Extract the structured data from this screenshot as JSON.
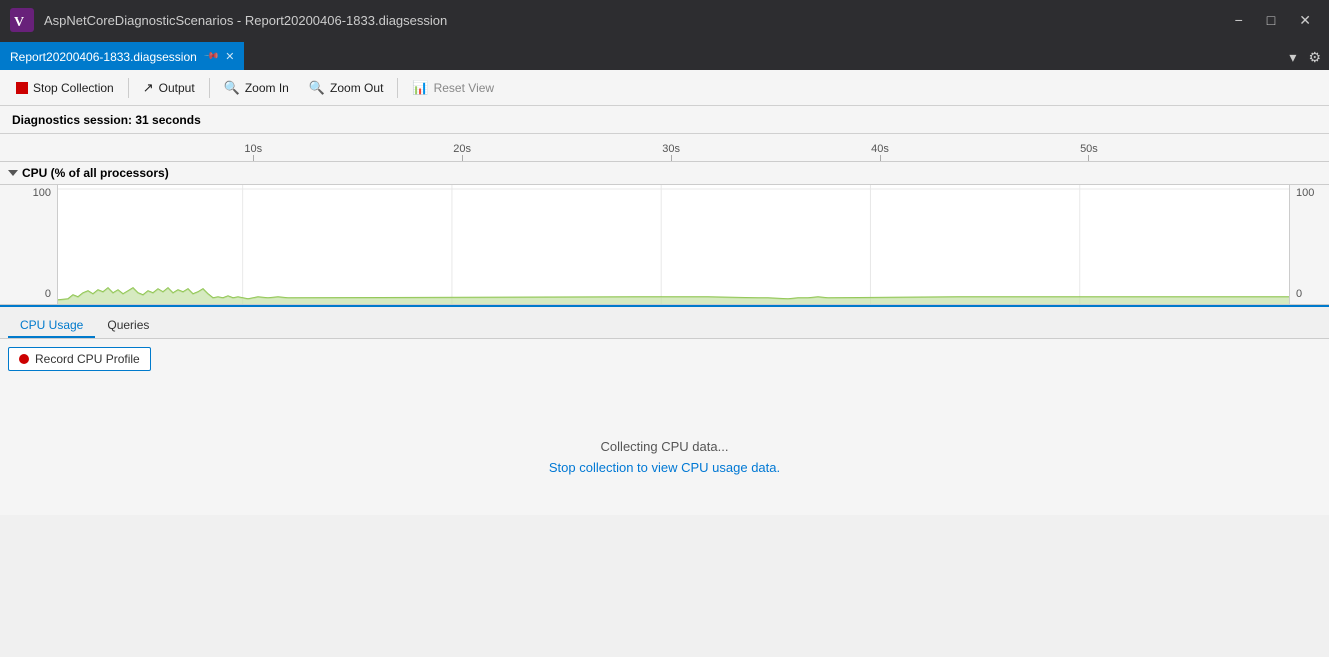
{
  "titleBar": {
    "appName": "AspNetCoreDiagnosticScenarios - Report20200406-1833.diagsession",
    "minimizeLabel": "−",
    "maximizeLabel": "□",
    "closeLabel": "✕"
  },
  "tabBar": {
    "tabName": "Report20200406-1833.diagsession",
    "pinSymbol": "📌",
    "closeSymbol": "✕",
    "dropdownSymbol": "▾",
    "settingsSymbol": "⚙"
  },
  "toolbar": {
    "stopCollection": "Stop Collection",
    "output": "Output",
    "zoomIn": "Zoom In",
    "zoomOut": "Zoom Out",
    "resetView": "Reset View"
  },
  "sessionInfo": {
    "text": "Diagnostics session: 31 seconds"
  },
  "ruler": {
    "marks": [
      "10s",
      "20s",
      "30s",
      "40s",
      "50s"
    ]
  },
  "chart": {
    "title": "CPU (% of all processors)",
    "yMax": "100",
    "yMin": "0",
    "yMaxRight": "100",
    "yMinRight": "0"
  },
  "bottomPanel": {
    "tabs": [
      "CPU Usage",
      "Queries"
    ],
    "activeTab": 0,
    "recordCpuLabel": "Record CPU Profile",
    "collectingMessage": "Collecting CPU data...",
    "stopLink": "Stop collection to view CPU usage data."
  }
}
